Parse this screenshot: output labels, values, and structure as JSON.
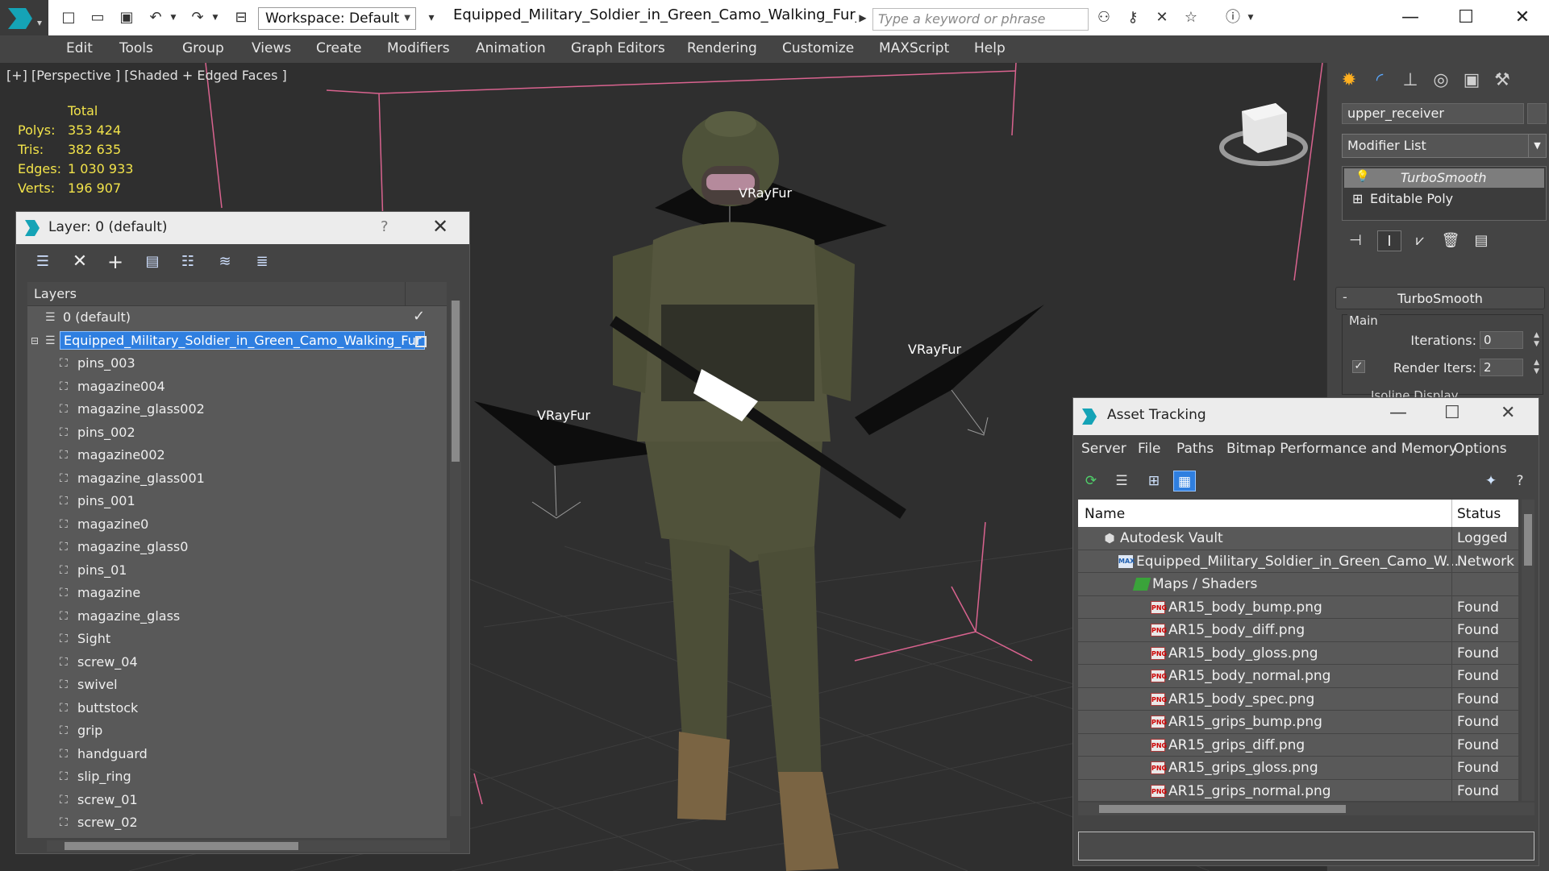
{
  "titlebar": {
    "workspace_label": "Workspace: Default",
    "document_title": "Equipped_Military_Soldier_in_Green_Camo_Walking_Fur_max...",
    "search_placeholder": "Type a keyword or phrase"
  },
  "menu": [
    "Edit",
    "Tools",
    "Group",
    "Views",
    "Create",
    "Modifiers",
    "Animation",
    "Graph Editors",
    "Rendering",
    "Customize",
    "MAXScript",
    "Help"
  ],
  "viewport": {
    "label": "[+] [Perspective ] [Shaded + Edged Faces ]",
    "stats": {
      "header": "Total",
      "rows": [
        {
          "key": "Polys:",
          "value": "353 424"
        },
        {
          "key": "Tris:",
          "value": "382 635"
        },
        {
          "key": "Edges:",
          "value": "1 030 933"
        },
        {
          "key": "Verts:",
          "value": "196 907"
        }
      ]
    },
    "fur_labels": [
      "VRayFur",
      "VRayFur",
      "VRayFur"
    ],
    "colors": {
      "background": "#2f2f2f",
      "grid": "#3c3c3c",
      "bounds": "#d9638f"
    }
  },
  "layer_dialog": {
    "title": "Layer: 0 (default)",
    "help": "?",
    "column_header": "Layers",
    "default_layer": "0 (default)",
    "selected_layer": "Equipped_Military_Soldier_in_Green_Camo_Walking_Fur",
    "items": [
      "pins_003",
      "magazine004",
      "magazine_glass002",
      "pins_002",
      "magazine002",
      "magazine_glass001",
      "pins_001",
      "magazine0",
      "magazine_glass0",
      "pins_01",
      "magazine",
      "magazine_glass",
      "Sight",
      "screw_04",
      "swivel",
      "buttstock",
      "grip",
      "handguard",
      "slip_ring",
      "screw_01",
      "screw_02"
    ]
  },
  "command_panel": {
    "object_name": "upper_receiver",
    "modifier_list": "Modifier List",
    "stack": [
      "TurboSmooth",
      "Editable Poly"
    ],
    "rollout_title": "TurboSmooth",
    "group_main": "Main",
    "iterations_label": "Iterations:",
    "iterations_value": "0",
    "render_iters_label": "Render Iters:",
    "render_iters_value": "2",
    "isoline_label": "Isoline Display"
  },
  "asset_tracking": {
    "title": "Asset Tracking",
    "menu": [
      "Server",
      "File",
      "Paths",
      "Bitmap Performance and Memory",
      "Options"
    ],
    "col_name": "Name",
    "col_status": "Status",
    "rows": [
      {
        "name": "Autodesk Vault",
        "status": "Logged",
        "indent": 52,
        "icon": "vault-icon"
      },
      {
        "name": "Equipped_Military_Soldier_in_Green_Camo_W...",
        "status": "Network",
        "indent": 72,
        "icon": "max-file-icon"
      },
      {
        "name": "Maps / Shaders",
        "status": "",
        "indent": 92,
        "icon": "maps-folder-icon"
      },
      {
        "name": "AR15_body_bump.png",
        "status": "Found",
        "indent": 112,
        "icon": "png-icon"
      },
      {
        "name": "AR15_body_diff.png",
        "status": "Found",
        "indent": 112,
        "icon": "png-icon"
      },
      {
        "name": "AR15_body_gloss.png",
        "status": "Found",
        "indent": 112,
        "icon": "png-icon"
      },
      {
        "name": "AR15_body_normal.png",
        "status": "Found",
        "indent": 112,
        "icon": "png-icon"
      },
      {
        "name": "AR15_body_spec.png",
        "status": "Found",
        "indent": 112,
        "icon": "png-icon"
      },
      {
        "name": "AR15_grips_bump.png",
        "status": "Found",
        "indent": 112,
        "icon": "png-icon"
      },
      {
        "name": "AR15_grips_diff.png",
        "status": "Found",
        "indent": 112,
        "icon": "png-icon"
      },
      {
        "name": "AR15_grips_gloss.png",
        "status": "Found",
        "indent": 112,
        "icon": "png-icon"
      },
      {
        "name": "AR15_grips_normal.png",
        "status": "Found",
        "indent": 112,
        "icon": "png-icon"
      }
    ]
  },
  "icons": {
    "png_badge": "PNG",
    "max_badge": "MAX"
  }
}
